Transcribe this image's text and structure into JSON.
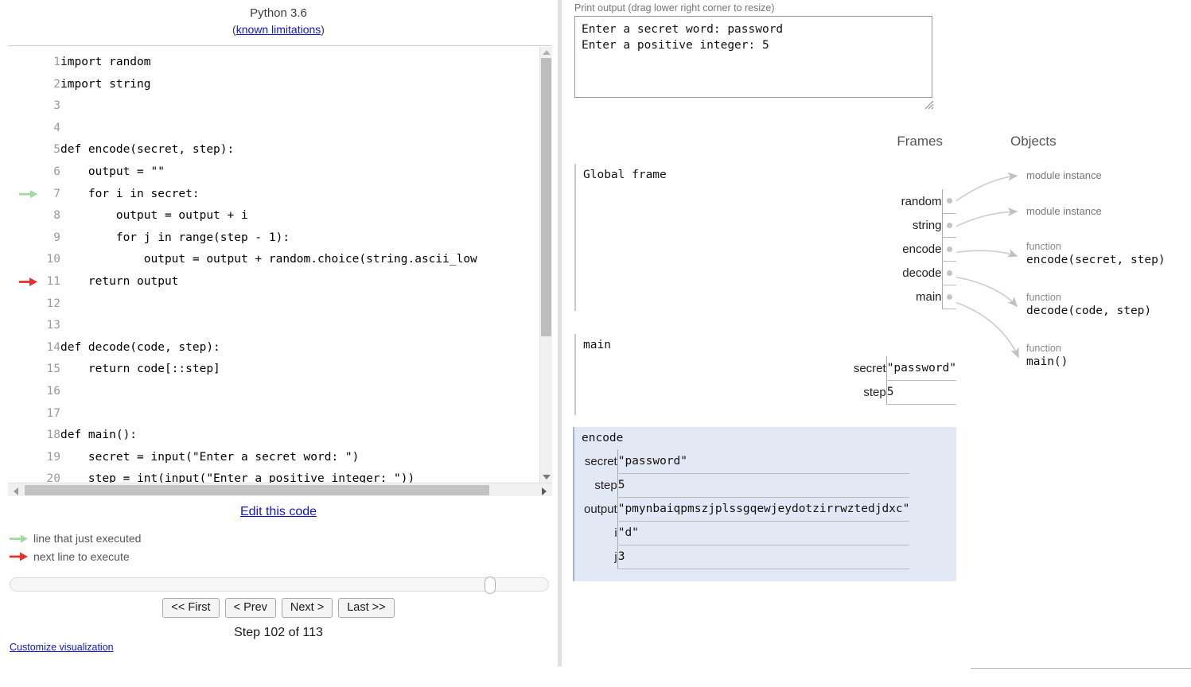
{
  "header": {
    "language": "Python 3.6",
    "limitations_prefix": "(",
    "limitations_link": "known limitations",
    "limitations_suffix": ")"
  },
  "code": {
    "lines": [
      {
        "n": "1",
        "text": "import random",
        "marker": ""
      },
      {
        "n": "2",
        "text": "import string",
        "marker": ""
      },
      {
        "n": "3",
        "text": "",
        "marker": ""
      },
      {
        "n": "4",
        "text": "",
        "marker": ""
      },
      {
        "n": "5",
        "text": "def encode(secret, step):",
        "marker": ""
      },
      {
        "n": "6",
        "text": "    output = \"\"",
        "marker": ""
      },
      {
        "n": "7",
        "text": "    for i in secret:",
        "marker": "green"
      },
      {
        "n": "8",
        "text": "        output = output + i",
        "marker": ""
      },
      {
        "n": "9",
        "text": "        for j in range(step - 1):",
        "marker": ""
      },
      {
        "n": "10",
        "text": "            output = output + random.choice(string.ascii_low",
        "marker": ""
      },
      {
        "n": "11",
        "text": "    return output",
        "marker": "red"
      },
      {
        "n": "12",
        "text": "",
        "marker": ""
      },
      {
        "n": "13",
        "text": "",
        "marker": ""
      },
      {
        "n": "14",
        "text": "def decode(code, step):",
        "marker": ""
      },
      {
        "n": "15",
        "text": "    return code[::step]",
        "marker": ""
      },
      {
        "n": "16",
        "text": "",
        "marker": ""
      },
      {
        "n": "17",
        "text": "",
        "marker": ""
      },
      {
        "n": "18",
        "text": "def main():",
        "marker": ""
      },
      {
        "n": "19",
        "text": "    secret = input(\"Enter a secret word: \")",
        "marker": ""
      },
      {
        "n": "20",
        "text": "    step = int(input(\"Enter a positive integer: \"))",
        "marker": ""
      }
    ]
  },
  "controls": {
    "edit_link": "Edit this code",
    "legend_green": "line that just executed",
    "legend_red": "next line to execute",
    "first_button": "<< First",
    "prev_button": "< Prev",
    "next_button": "Next >",
    "last_button": "Last >>",
    "step_label": "Step 102 of 113",
    "customize_link": "Customize visualization",
    "step_current": 102,
    "step_total": 113
  },
  "print_output": {
    "label": "Print output (drag lower right corner to resize)",
    "text": "Enter a secret word: password\nEnter a positive integer: 5"
  },
  "columns": {
    "frames": "Frames",
    "objects": "Objects"
  },
  "frames": [
    {
      "name": "Global frame",
      "active": false,
      "vars": [
        {
          "label": "random",
          "value": "",
          "pointer": true
        },
        {
          "label": "string",
          "value": "",
          "pointer": true
        },
        {
          "label": "encode",
          "value": "",
          "pointer": true
        },
        {
          "label": "decode",
          "value": "",
          "pointer": true
        },
        {
          "label": "main",
          "value": "",
          "pointer": true
        }
      ]
    },
    {
      "name": "main",
      "active": false,
      "vars": [
        {
          "label": "secret",
          "value": "\"password\"",
          "pointer": false
        },
        {
          "label": "step",
          "value": "5",
          "pointer": false
        }
      ]
    },
    {
      "name": "encode",
      "active": true,
      "vars": [
        {
          "label": "secret",
          "value": "\"password\"",
          "pointer": false
        },
        {
          "label": "step",
          "value": "5",
          "pointer": false
        },
        {
          "label": "output",
          "value": "\"pmynbaiqpmszjplssgqewjeydotzirrwztedjdxc\"",
          "pointer": false
        },
        {
          "label": "i",
          "value": "\"d\"",
          "pointer": false
        },
        {
          "label": "j",
          "value": "3",
          "pointer": false
        }
      ]
    }
  ],
  "objects": [
    {
      "type": "module instance",
      "body": ""
    },
    {
      "type": "module instance",
      "body": ""
    },
    {
      "type": "function",
      "body": "encode(secret, step)"
    },
    {
      "type": "function",
      "body": "decode(code, step)"
    },
    {
      "type": "function",
      "body": "main()"
    }
  ],
  "colors": {
    "link": "#1414cc",
    "green_arrow": "#a2d9a2",
    "red_arrow": "#e8302a",
    "active_frame_bg": "#e2e8f4",
    "active_frame_border": "#a2b5cd",
    "pointer_gray": "#c4c4c4",
    "label_gray": "#777777"
  }
}
